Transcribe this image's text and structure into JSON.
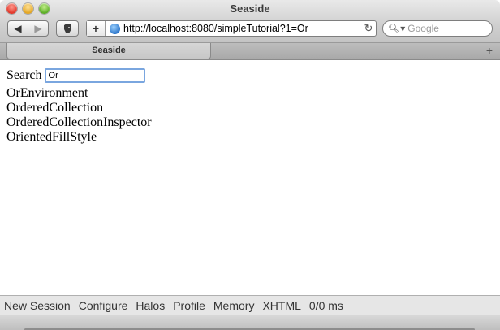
{
  "window": {
    "title": "Seaside"
  },
  "toolbar": {
    "back_label": "◀",
    "forward_label": "▶",
    "extension_icon": "evernote-icon",
    "add_bookmark_label": "+",
    "url": "http://localhost:8080/simpleTutorial?1=Or",
    "reload_label": "↻",
    "search_placeholder": "Google"
  },
  "tabs": [
    {
      "label": "Seaside"
    }
  ],
  "page": {
    "search_label": "Search",
    "search_value": "Or",
    "results": [
      "OrEnvironment",
      "OrderedCollection",
      "OrderedCollectionInspector",
      "OrientedFillStyle"
    ]
  },
  "seaside_toolbar": {
    "items": [
      "New Session",
      "Configure",
      "Halos",
      "Profile",
      "Memory",
      "XHTML"
    ],
    "timing": "0/0 ms"
  }
}
